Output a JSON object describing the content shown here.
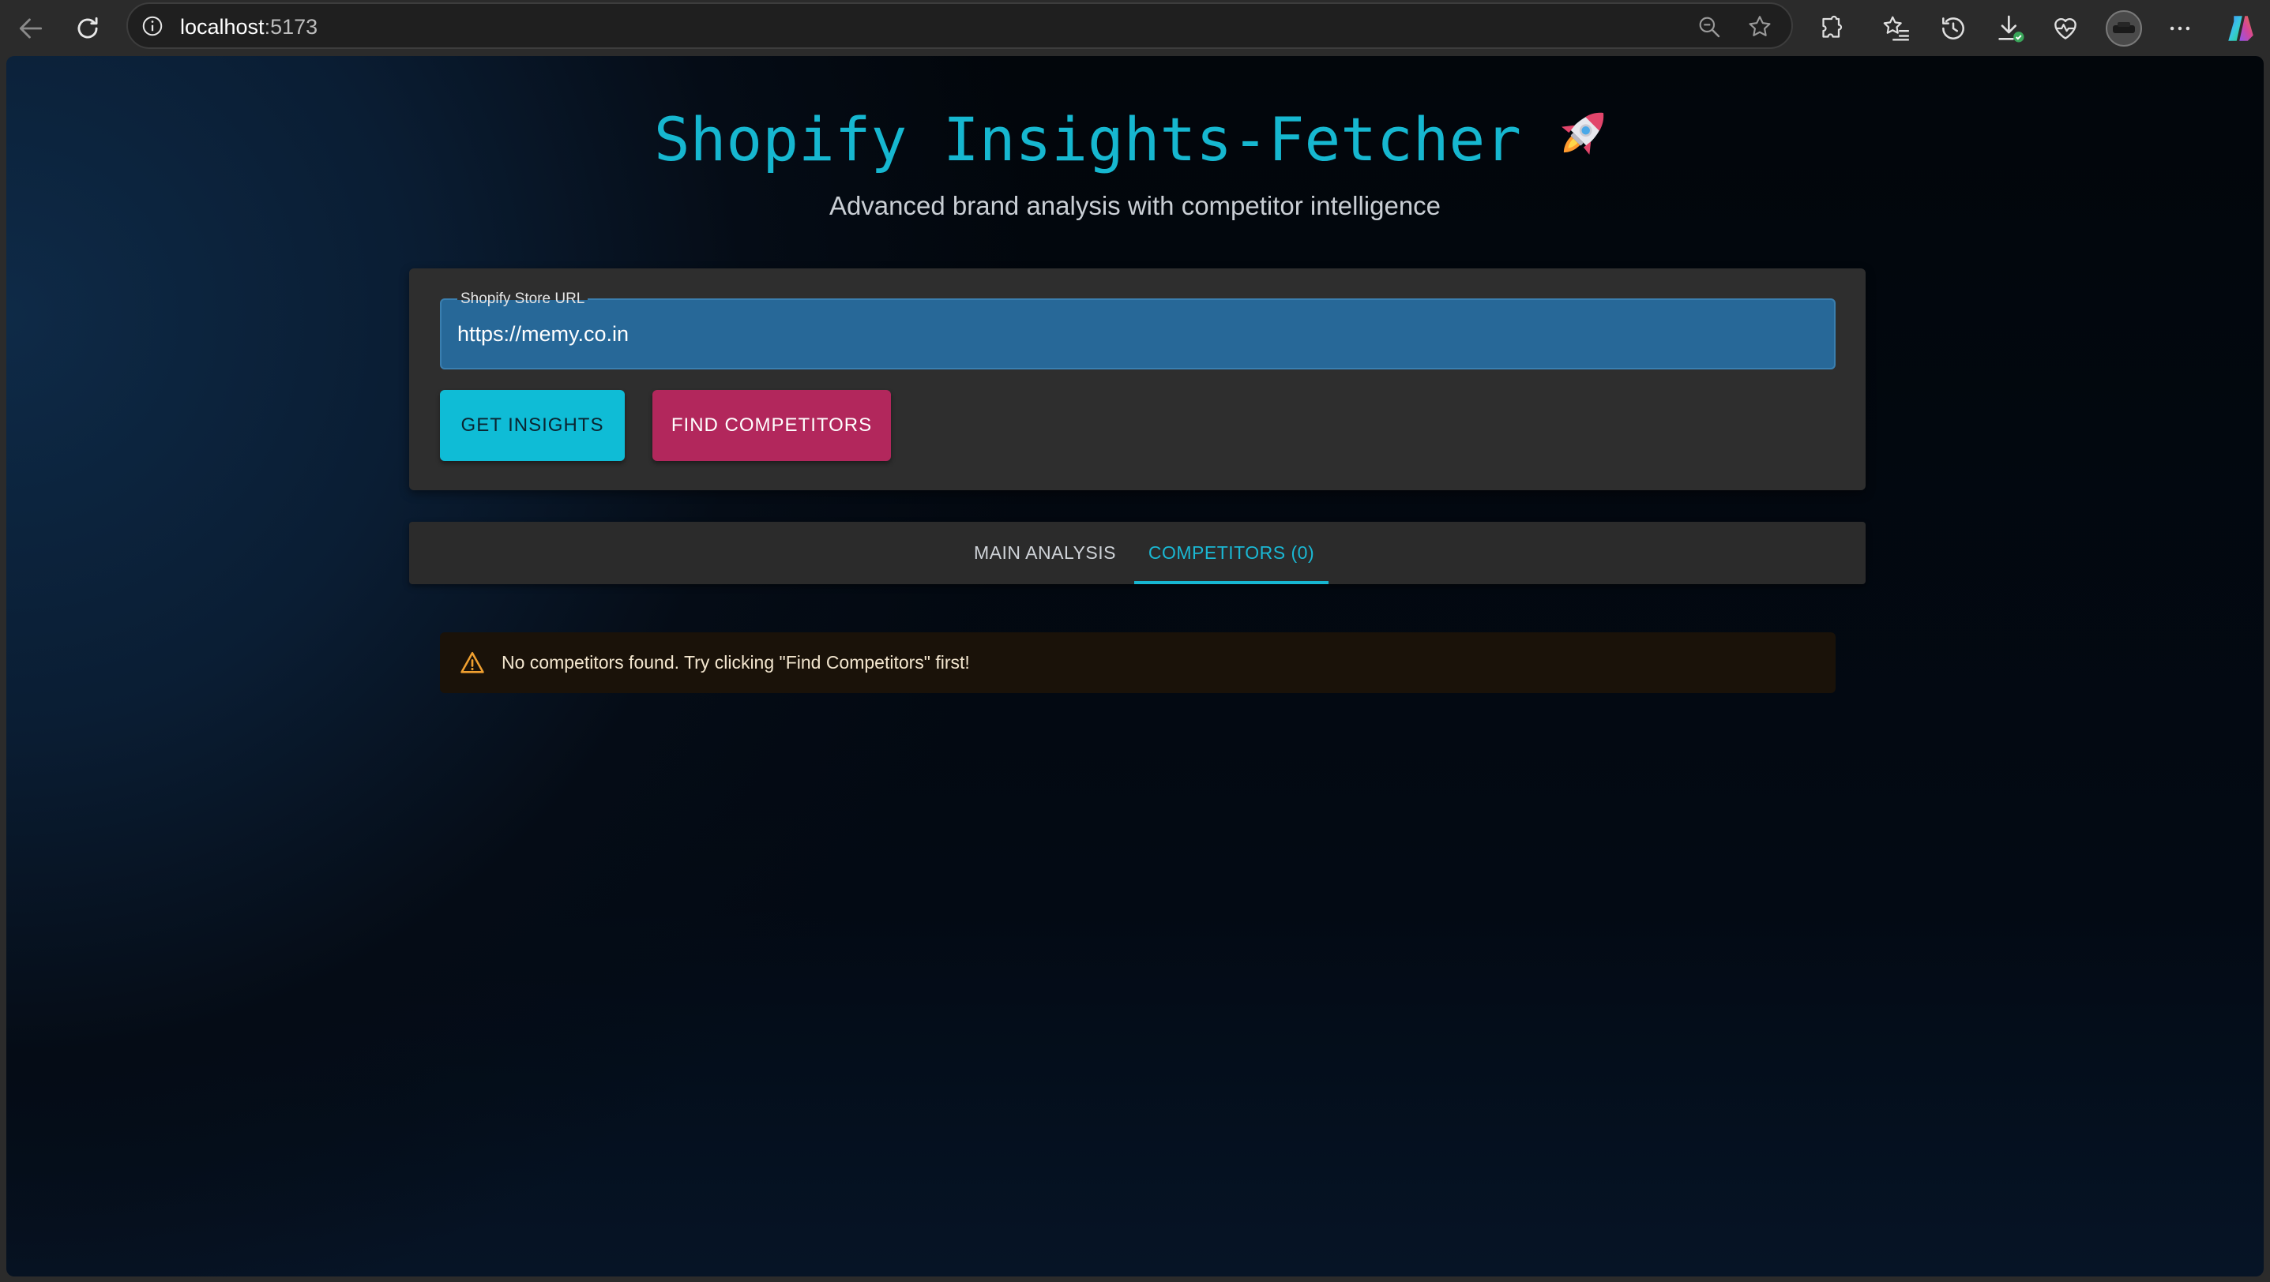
{
  "browser": {
    "url_host": "localhost",
    "url_port": ":5173",
    "icons": {
      "back": "arrow-left-icon",
      "reload": "reload-icon",
      "site_info": "info-icon",
      "zoom": "zoom-out-icon",
      "favorite": "star-icon",
      "extensions": "puzzle-icon",
      "favorites": "favorites-list-icon",
      "history": "history-icon",
      "downloads": "download-icon",
      "performance": "heart-pulse-icon",
      "profile": "avatar",
      "more": "more-dots-icon",
      "copilot": "copilot-icon"
    }
  },
  "app": {
    "title": "Shopify Insights-Fetcher",
    "subtitle": "Advanced brand analysis with competitor intelligence",
    "form": {
      "url_label": "Shopify Store URL",
      "url_value": "https://memy.co.in",
      "get_insights_label": "GET INSIGHTS",
      "find_competitors_label": "FIND COMPETITORS"
    },
    "tabs": [
      {
        "label": "MAIN ANALYSIS",
        "active": false
      },
      {
        "label": "COMPETITORS (0)",
        "active": true
      }
    ],
    "alert": {
      "message": "No competitors found. Try clicking \"Find Competitors\" first!",
      "severity": "warning"
    }
  },
  "colors": {
    "accent": "#16b7d0",
    "secondary": "#b2275c",
    "input_bg": "#276898",
    "warning": "#f0a030"
  }
}
